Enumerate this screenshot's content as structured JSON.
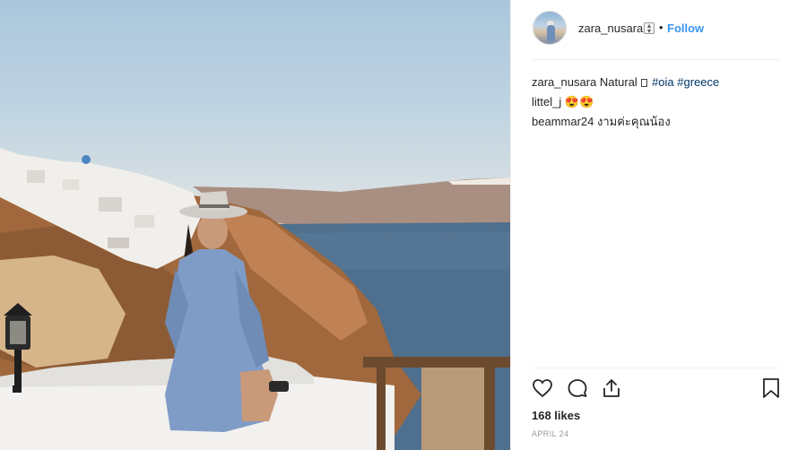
{
  "post": {
    "photo_alt": "Woman in blue dress and hat sitting on a white terrace wall in Oia, Santorini",
    "header": {
      "username": "zara_nusara",
      "dot": "•",
      "follow_label": "Follow"
    },
    "caption": {
      "username": "zara_nusara",
      "text": "Natural",
      "hashtags": [
        "#oia",
        "#greece"
      ]
    },
    "comments": [
      {
        "username": "littel_j",
        "text": "😍😍"
      },
      {
        "username": "beammar24",
        "text": "งามค่ะคุณน้อง"
      }
    ],
    "actions": {
      "like_icon": "heart-icon",
      "comment_icon": "comment-icon",
      "share_icon": "share-icon",
      "save_icon": "bookmark-icon"
    },
    "likes_text": "168 likes",
    "date_text": "APRIL 24",
    "colors": {
      "link_blue": "#3897f0",
      "hashtag": "#003569",
      "meta_gray": "#999999",
      "dress_blue": "#7f9cc6",
      "sea": "#4e6f8e"
    }
  }
}
